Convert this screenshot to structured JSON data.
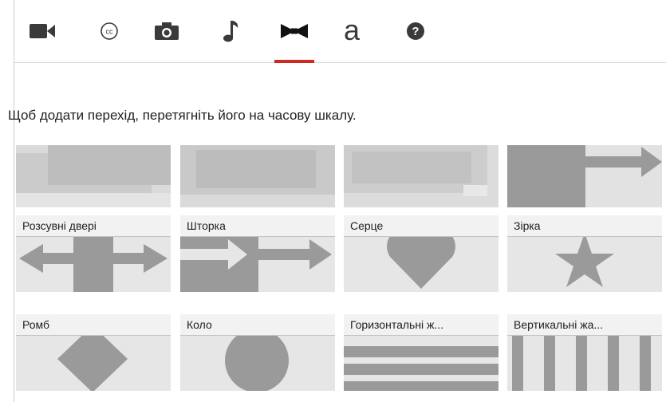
{
  "toolbar": {
    "icons": [
      {
        "name": "video-camera-icon",
        "active": false
      },
      {
        "name": "closed-captions-icon",
        "active": false,
        "glyph": "cc"
      },
      {
        "name": "photo-camera-icon",
        "active": false
      },
      {
        "name": "music-note-icon",
        "active": false
      },
      {
        "name": "transitions-bowtie-icon",
        "active": true
      },
      {
        "name": "text-a-icon",
        "active": false,
        "glyph": "a"
      },
      {
        "name": "help-icon",
        "active": false,
        "glyph": "?"
      }
    ],
    "accent_color": "#cc2a1e"
  },
  "instruction": "Щоб додати перехід, перетягніть його на часову шкалу.",
  "transitions": {
    "row2": [
      "Розсувні двері",
      "Шторка",
      "Серце",
      "Зірка"
    ],
    "row3": [
      "Ромб",
      "Коло",
      "Горизонтальні ж...",
      "Вертикальні жа..."
    ]
  }
}
